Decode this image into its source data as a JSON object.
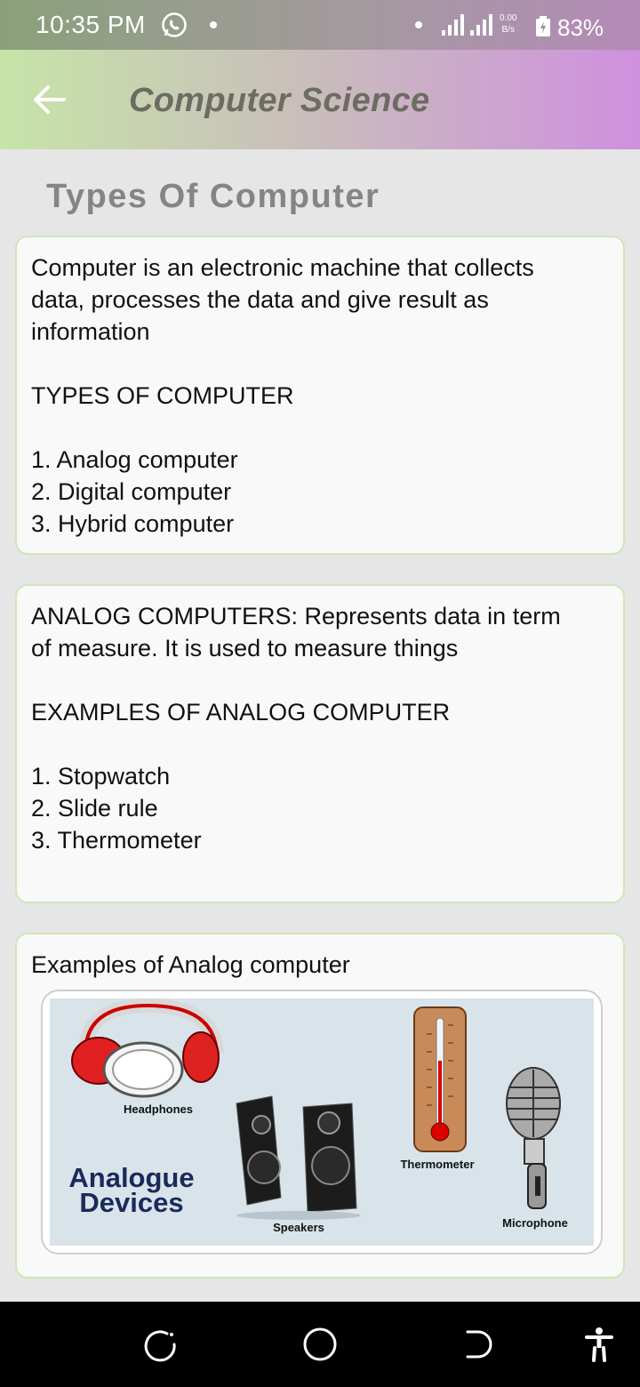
{
  "status_bar": {
    "time": "10:35 PM",
    "net_speed_value": "0.00",
    "net_speed_unit": "B/s",
    "battery": "83%"
  },
  "app_bar": {
    "title": "Computer Science",
    "back_icon": "arrow-left-icon"
  },
  "page": {
    "title": "Types Of Computer"
  },
  "cards": [
    {
      "intro": [
        "Computer is an electronic machine that collects",
        "data, processes the data and give result as",
        "information"
      ],
      "heading": "TYPES OF COMPUTER",
      "items": [
        "1. Analog computer",
        "2. Digital computer",
        "3. Hybrid computer"
      ]
    },
    {
      "intro": [
        "ANALOG COMPUTERS: Represents data in term",
        "of measure. It is used to measure things"
      ],
      "heading": "EXAMPLES OF ANALOG COMPUTER",
      "items": [
        "1. Stopwatch",
        "2. Slide rule",
        "3. Thermometer"
      ]
    },
    {
      "caption": "Examples of Analog computer",
      "image": {
        "title_line1": "Analogue",
        "title_line2": "Devices",
        "labels": [
          "Headphones",
          "Speakers",
          "Thermometer",
          "Microphone"
        ]
      }
    }
  ],
  "colors": {
    "accent_green": "#cfe6b8",
    "title_blue": "#1a2a5a"
  }
}
